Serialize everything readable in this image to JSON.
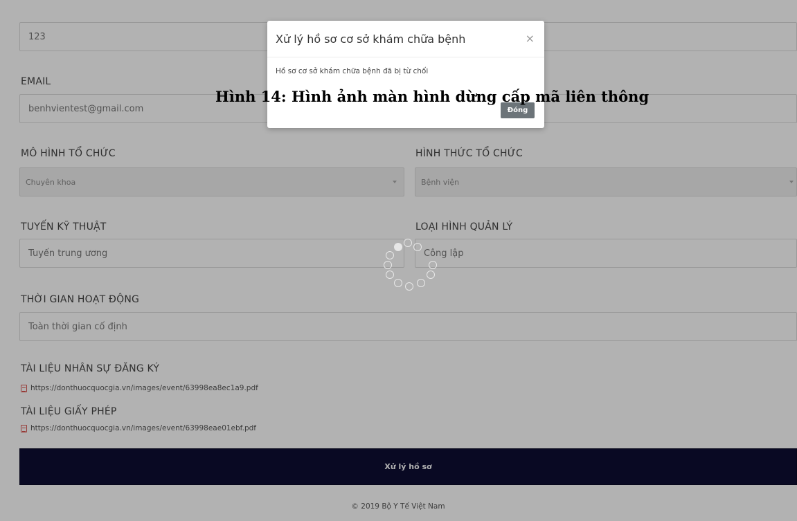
{
  "form": {
    "top_field_value": "123",
    "email_label": "EMAIL",
    "email_value": "benhvientest@gmail.com",
    "org_model_label": "MÔ HÌNH TỔ CHỨC",
    "org_model_value": "Chuyên khoa",
    "org_form_label": "HÌNH THỨC TỔ CHỨC",
    "org_form_value": "Bệnh viện",
    "tech_level_label": "TUYẾN KỸ THUẬT",
    "tech_level_value": "Tuyến trung ương",
    "mgmt_type_label": "LOẠI HÌNH QUẢN LÝ",
    "mgmt_type_value": "Công lập",
    "hours_label": "THỜI GIAN HOẠT ĐỘNG",
    "hours_value": "Toàn thời gian cố định",
    "staff_docs_label": "TÀI LIỆU NHÂN SỰ ĐĂNG KÝ",
    "staff_docs_link": "https://donthuocquocgia.vn/images/event/63998ea8ec1a9.pdf",
    "license_docs_label": "TÀI LIỆU GIẤY PHÉP",
    "license_docs_link": "https://donthuocquocgia.vn/images/event/63998eae01ebf.pdf",
    "submit_label": "Xử lý hồ sơ"
  },
  "footer": {
    "text": "© 2019 Bộ Y Tế Việt Nam"
  },
  "modal": {
    "title": "Xử lý hồ sơ cơ sở khám chữa bệnh",
    "close": "×",
    "message": "Hồ sơ cơ sở khám chữa bệnh đã bị từ chối",
    "button": "Đóng"
  },
  "caption": "Hình 14: Hình ảnh màn hình dừng cấp mã liên thông",
  "colors": {
    "submit_bg": "#0d0d33",
    "modal_button": "#6c7479",
    "pdf_icon": "#d9534f"
  },
  "icons": [
    "pdf-icon",
    "close-icon",
    "chevron-down-icon",
    "loading-spinner-icon"
  ]
}
